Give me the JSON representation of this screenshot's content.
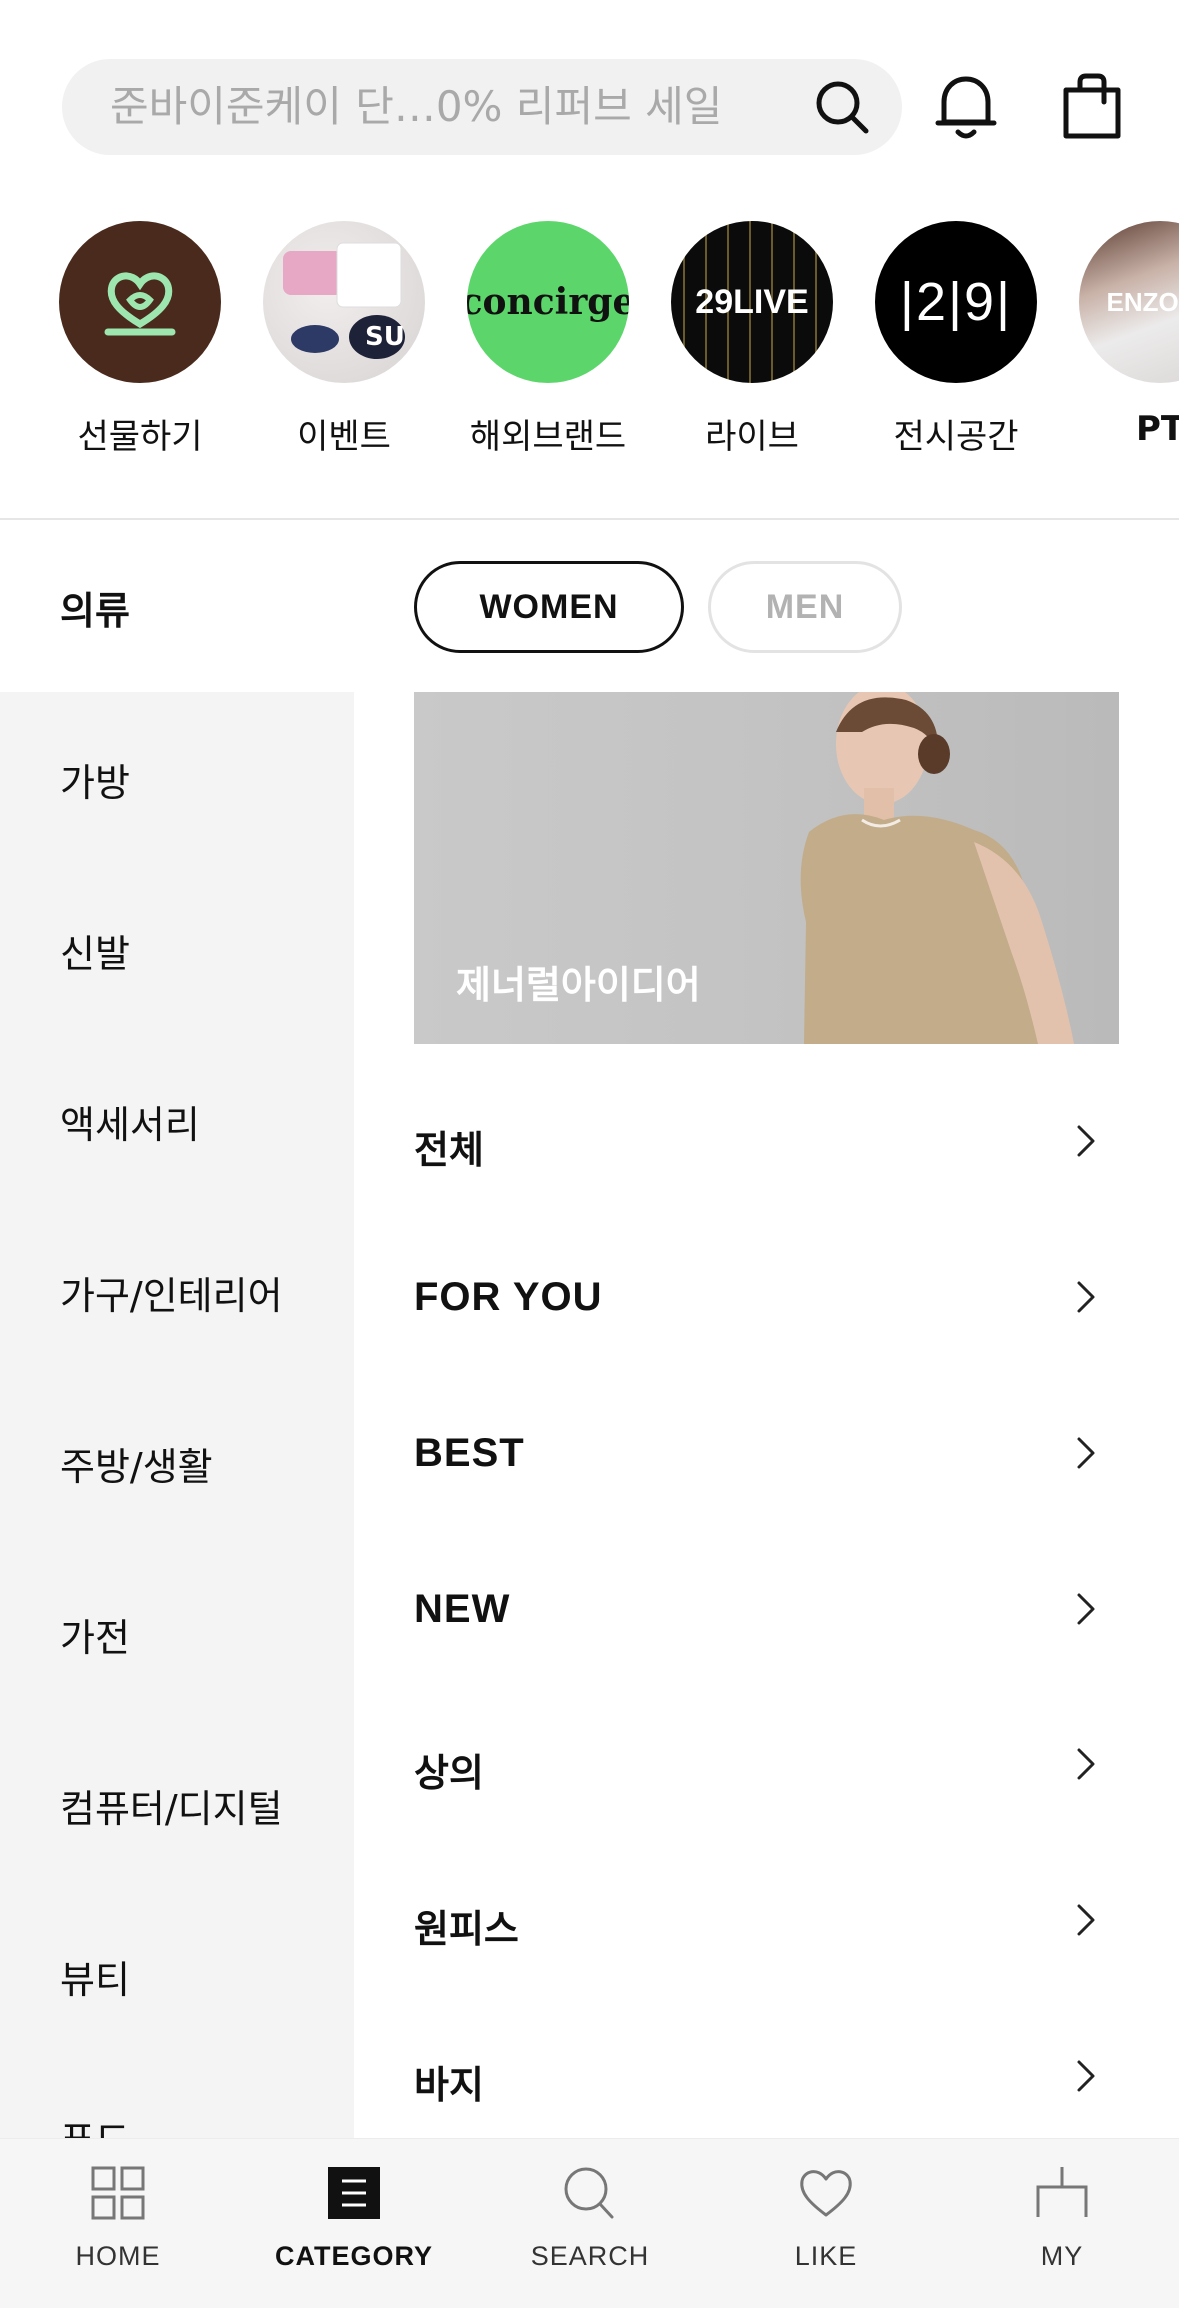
{
  "search": {
    "placeholder": "준바이준케이 단…0% 리퍼브 세일"
  },
  "header_icons": [
    "search-icon",
    "bell-icon",
    "shopping-bag-icon"
  ],
  "stories": [
    {
      "label": "선물하기",
      "circle_text": "",
      "bg": "#4a2a1c",
      "fg": "#9ee6b0"
    },
    {
      "label": "이벤트",
      "circle_text": "",
      "bg": "#e6e0df",
      "fg": ""
    },
    {
      "label": "해외브랜드",
      "circle_text": "concirge",
      "bg": "#5cd66b",
      "fg": "#111111"
    },
    {
      "label": "라이브",
      "circle_text": "29LIVE",
      "bg": "#0b0b0b",
      "fg": "#ffffff"
    },
    {
      "label": "전시공간",
      "circle_text": "|2|9|",
      "bg": "#000000",
      "fg": "#ffffff"
    },
    {
      "label": "PT",
      "circle_text": "ENZOBL",
      "bg": "#d9d6d4",
      "fg": "#ffffff"
    }
  ],
  "sidebar": {
    "items": [
      {
        "label": "의류",
        "active": true
      },
      {
        "label": "가방"
      },
      {
        "label": "신발"
      },
      {
        "label": "액세서리"
      },
      {
        "label": "가구/인테리어"
      },
      {
        "label": "주방/생활"
      },
      {
        "label": "가전"
      },
      {
        "label": "컴퓨터/디지털"
      },
      {
        "label": "뷰티"
      },
      {
        "label": "푸드"
      }
    ]
  },
  "gender_toggle": {
    "women": "WOMEN",
    "men": "MEN",
    "selected": "WOMEN"
  },
  "banner": {
    "title": "제너럴아이디어"
  },
  "categories": [
    {
      "label": "전체"
    },
    {
      "label": "FOR YOU"
    },
    {
      "label": "BEST"
    },
    {
      "label": "NEW"
    },
    {
      "label": "상의"
    },
    {
      "label": "원피스"
    },
    {
      "label": "바지"
    }
  ],
  "bottom_nav": {
    "items": [
      {
        "label": "HOME",
        "icon": "grid-icon"
      },
      {
        "label": "CATEGORY",
        "icon": "list-icon",
        "active": true
      },
      {
        "label": "SEARCH",
        "icon": "search-icon"
      },
      {
        "label": "LIKE",
        "icon": "heart-icon"
      },
      {
        "label": "MY",
        "icon": "person-icon"
      }
    ]
  }
}
